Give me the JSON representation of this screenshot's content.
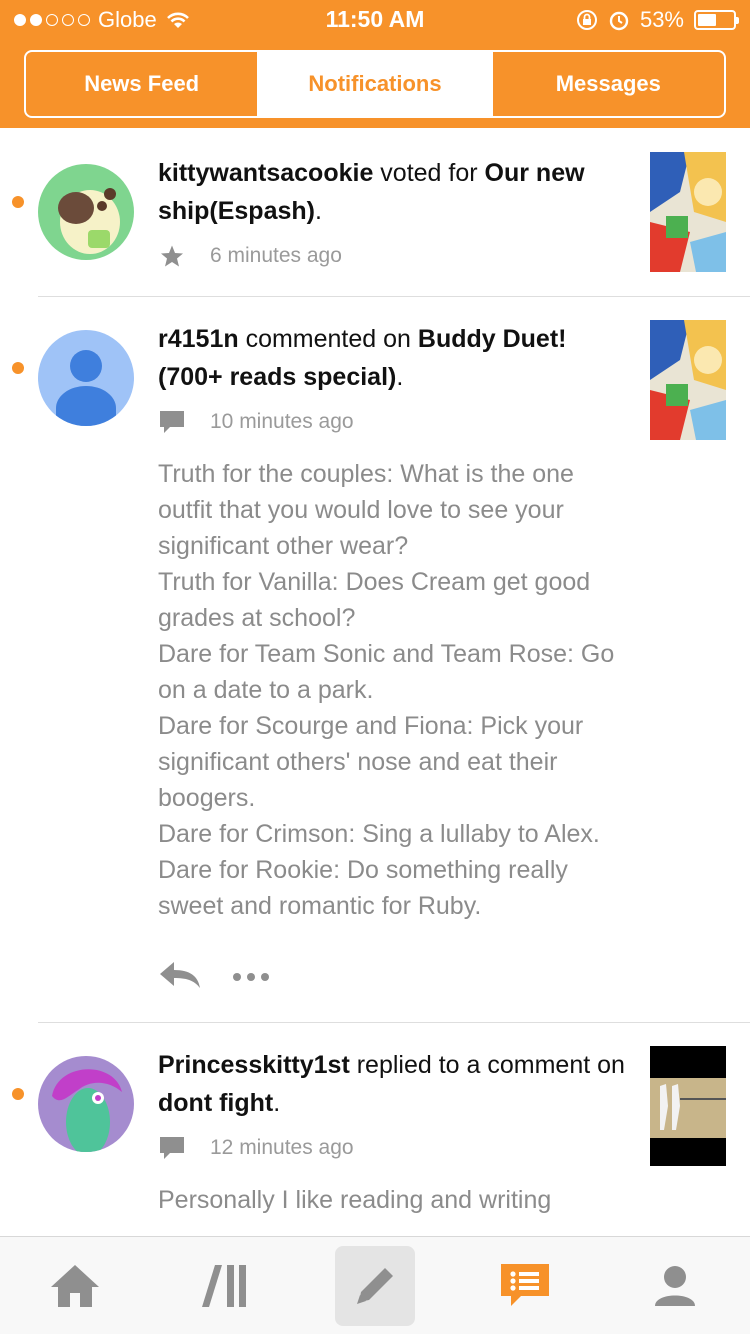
{
  "status_bar": {
    "carrier": "Globe",
    "time": "11:50 AM",
    "battery_percent": "53%",
    "battery_level": 0.53,
    "signal_bars_filled": 2,
    "signal_bars_total": 5
  },
  "segments": {
    "news_feed": "News Feed",
    "notifications": "Notifications",
    "messages": "Messages",
    "selected": "Notifications"
  },
  "colors": {
    "accent": "#f7922a",
    "unread": "#f7922a",
    "icon_gray": "#8f8f8f"
  },
  "notifications": [
    {
      "user": "kittywantsacookie",
      "action": " voted for ",
      "target": "Our new ship(Espash)",
      "end": ".",
      "time": "6 minutes ago",
      "type_icon": "star-icon",
      "unread": true
    },
    {
      "user": "r4151n",
      "action": " commented on ",
      "target": "Buddy Duet! (700+ reads special)",
      "end": ".",
      "time": "10 minutes ago",
      "type_icon": "comment-icon",
      "unread": true,
      "comment_lines": [
        "Truth for the couples: What is the one outfit that you would love to see your significant other wear?",
        "Truth for Vanilla: Does Cream get good grades at school?",
        "Dare for Team Sonic and Team Rose: Go on a date to a park.",
        "Dare for Scourge and Fiona: Pick your significant others' nose and eat their boogers.",
        "Dare for Crimson: Sing a lullaby to Alex.",
        "Dare for Rookie: Do something really sweet and romantic for Ruby."
      ]
    },
    {
      "user": "Princesskitty1st",
      "action": " replied to a comment on ",
      "target": "dont fight",
      "end": ".",
      "time": "12 minutes ago",
      "type_icon": "comment-icon",
      "unread": true,
      "comment_preview": "Personally I like reading and writing"
    }
  ],
  "tab_bar": {
    "items": [
      "home-icon",
      "stories-icon",
      "compose-icon",
      "notifications-icon",
      "profile-icon"
    ],
    "active": "notifications-icon"
  }
}
